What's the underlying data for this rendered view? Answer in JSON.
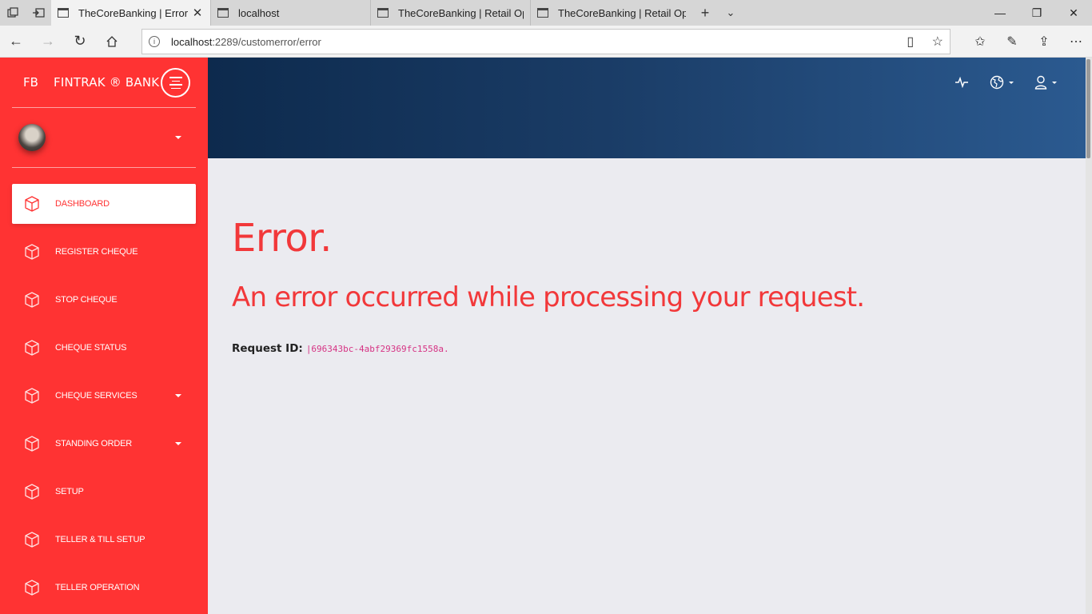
{
  "browser": {
    "tabs": [
      {
        "label": "TheCoreBanking | Error",
        "active": true
      },
      {
        "label": "localhost",
        "active": false
      },
      {
        "label": "TheCoreBanking | Retail Op",
        "active": false
      },
      {
        "label": "TheCoreBanking | Retail Op",
        "active": false
      }
    ],
    "url_host": "localhost",
    "url_path": ":2289/customerror/error"
  },
  "sidebar": {
    "brand_mini": "FB",
    "brand_name": "FINTRAK ® BANK",
    "items": [
      {
        "label": "DASHBOARD",
        "active": true,
        "has_caret": false
      },
      {
        "label": "REGISTER CHEQUE",
        "active": false,
        "has_caret": false
      },
      {
        "label": "STOP CHEQUE",
        "active": false,
        "has_caret": false
      },
      {
        "label": "CHEQUE STATUS",
        "active": false,
        "has_caret": false
      },
      {
        "label": "CHEQUE SERVICES",
        "active": false,
        "has_caret": true
      },
      {
        "label": "STANDING ORDER",
        "active": false,
        "has_caret": true
      },
      {
        "label": "SETUP",
        "active": false,
        "has_caret": false
      },
      {
        "label": "TELLER & TILL SETUP",
        "active": false,
        "has_caret": false
      },
      {
        "label": "TELLER OPERATION",
        "active": false,
        "has_caret": false
      }
    ]
  },
  "header": {
    "icons": [
      "activity-icon",
      "globe-icon",
      "user-icon"
    ]
  },
  "content": {
    "title": "Error.",
    "subtitle": "An error occurred while processing your request.",
    "request_label": "Request ID:",
    "request_id": "|696343bc-4abf29369fc1558a."
  },
  "colors": {
    "sidebar": "#ff3333",
    "error_text": "#f2383a",
    "header_from": "#0d2a4d",
    "header_to": "#2b5a90",
    "request_id": "#d63384"
  }
}
